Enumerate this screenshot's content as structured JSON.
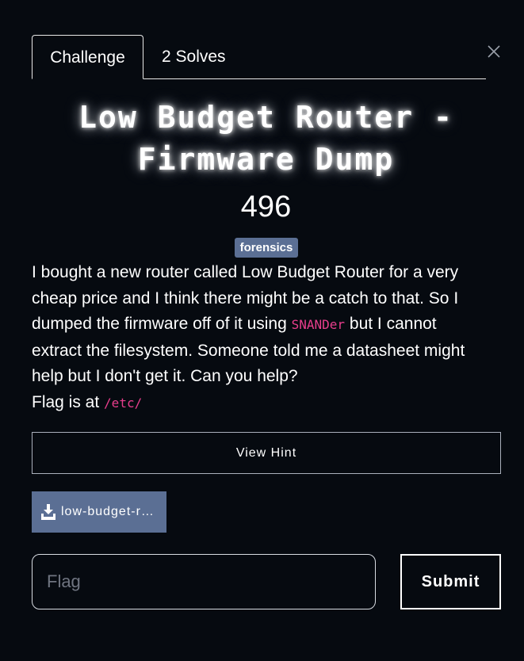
{
  "tabs": [
    {
      "label": "Challenge",
      "active": true
    },
    {
      "label": "2 Solves",
      "active": false
    }
  ],
  "challenge": {
    "title": "Low Budget Router - Firmware Dump",
    "points": "496",
    "category": "forensics",
    "description": {
      "part1": "I bought a new router called Low Budget Router for a very cheap price and I think there might be a catch to that. So I dumped the firmware off of it using ",
      "tool": "SNANDer",
      "part2": " but I cannot extract the filesystem. Someone told me a datasheet might help but I don't get it. Can you help?",
      "flag_prefix": "Flag is at ",
      "flag_path": "/etc/"
    },
    "hint_label": "View Hint",
    "file_label": "low-budget-r…"
  },
  "flag_form": {
    "placeholder": "Flag",
    "value": "",
    "submit_label": "Submit"
  },
  "colors": {
    "background": "#060a10",
    "badge": "#5b6f94",
    "code": "#e83e8c"
  },
  "icons": {
    "close": "close-icon",
    "download": "download-icon"
  }
}
